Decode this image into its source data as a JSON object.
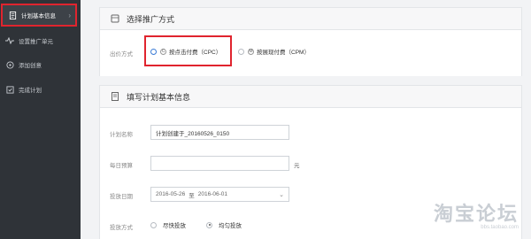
{
  "sidebar": {
    "items": [
      {
        "label": "计划基本信息",
        "icon": "document-icon",
        "active": true
      },
      {
        "label": "设置推广单元",
        "icon": "pulse-icon"
      },
      {
        "label": "添加创意",
        "icon": "circle-icon"
      },
      {
        "label": "完成计划",
        "icon": "flag-icon"
      }
    ]
  },
  "section1": {
    "title": "选择推广方式",
    "icon": "cube-icon",
    "bid_label": "出价方式",
    "options": [
      {
        "label": "按点击付费（CPC）",
        "selected": true
      },
      {
        "label": "按展现付费（CPM）",
        "selected": false
      }
    ]
  },
  "section2": {
    "title": "填写计划基本信息",
    "icon": "file-icon",
    "plan_name_label": "计划名称",
    "plan_name_value": "计划创建于_20160526_0150",
    "budget_label": "每日预算",
    "budget_value": "",
    "budget_unit": "元",
    "date_label": "投放日期",
    "date_start": "2016-05-26",
    "date_sep": "至",
    "date_end": "2016-06-01",
    "delivery_label": "投放方式",
    "delivery_options": [
      {
        "label": "尽快投放",
        "selected": false
      },
      {
        "label": "均匀投放",
        "selected": true
      }
    ]
  },
  "watermark": {
    "text": "淘宝论坛",
    "url": "bbs.taobao.com"
  }
}
